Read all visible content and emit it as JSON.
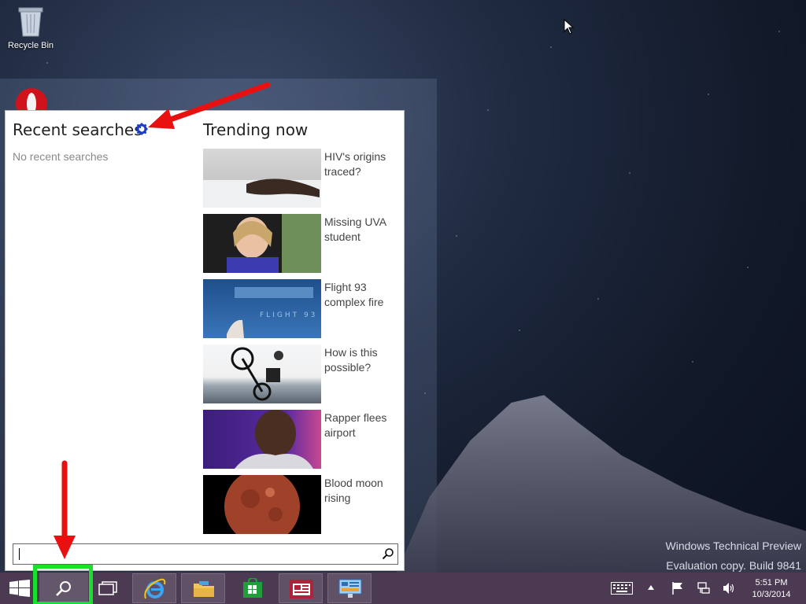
{
  "desktop": {
    "recycle_bin_label": "Recycle Bin",
    "watermark_line1": "Windows Technical Preview",
    "watermark_line2": "Evaluation copy. Build 9841"
  },
  "search_panel": {
    "recent_title": "Recent searches",
    "no_recent": "No recent searches",
    "trending_title": "Trending now",
    "trending": [
      {
        "label": "HIV's origins traced?",
        "icon": "hiv-photo"
      },
      {
        "label": "Missing UVA student",
        "icon": "student-photo"
      },
      {
        "label": "Flight 93 complex fire",
        "icon": "flight93-photo"
      },
      {
        "label": "How is this possible?",
        "icon": "bike-photo"
      },
      {
        "label": "Rapper flees airport",
        "icon": "rapper-photo"
      },
      {
        "label": "Blood moon rising",
        "icon": "moon-photo"
      }
    ],
    "search_input_value": ""
  },
  "taskbar": {
    "apps": [
      "start",
      "search",
      "task-view",
      "internet-explorer",
      "file-explorer",
      "store",
      "news",
      "control-panel"
    ],
    "clock_time": "5:51 PM",
    "clock_date": "10/3/2014"
  },
  "colors": {
    "taskbar": "#4b3a52",
    "highlight": "#19e02a",
    "annotation_arrow": "#e81010",
    "gear": "#1a3cc8"
  }
}
